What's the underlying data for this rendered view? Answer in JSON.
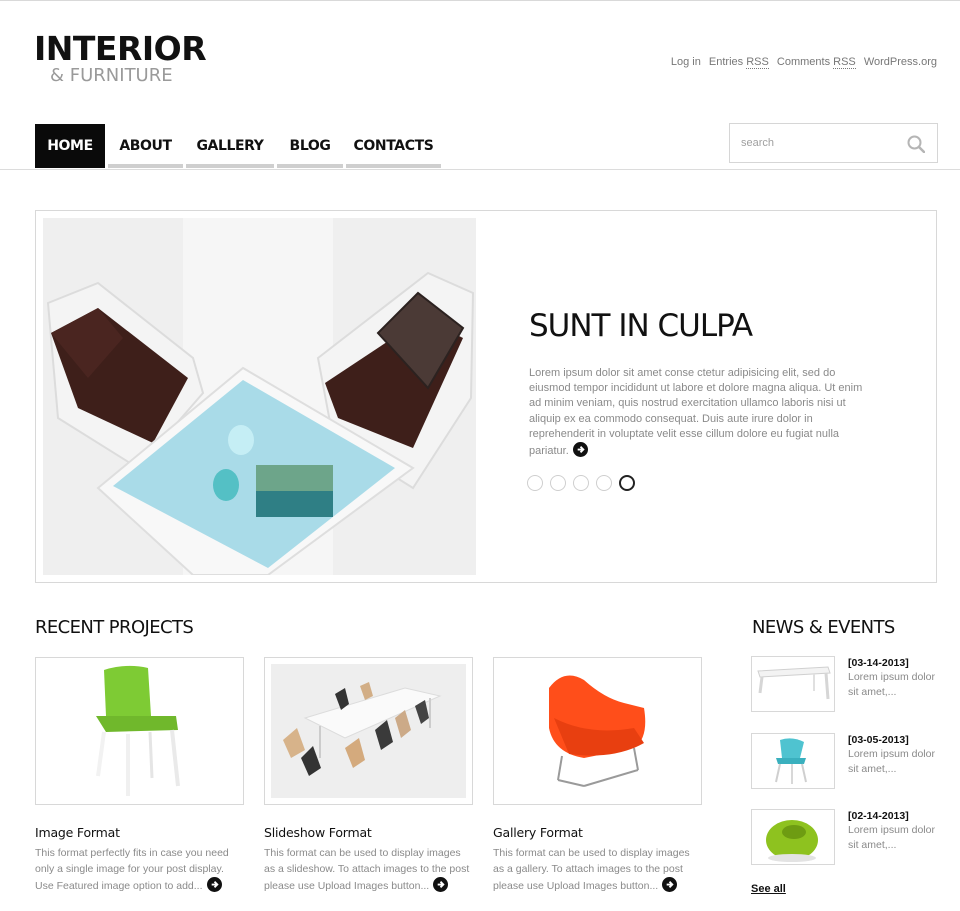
{
  "logo": {
    "title": "INTERIOR",
    "subtitle": "& FURNITURE"
  },
  "meta_links": [
    {
      "label": "Log in"
    },
    {
      "prefix": "Entries ",
      "abbr": "RSS"
    },
    {
      "prefix": "Comments ",
      "abbr": "RSS"
    },
    {
      "label": "WordPress.org"
    }
  ],
  "nav": [
    {
      "label": "HOME",
      "active": true
    },
    {
      "label": "ABOUT",
      "active": false
    },
    {
      "label": "GALLERY",
      "active": false
    },
    {
      "label": "BLOG",
      "active": false
    },
    {
      "label": "CONTACTS",
      "active": false
    }
  ],
  "search": {
    "placeholder": "search"
  },
  "slider": {
    "title": "SUNT IN CULPA",
    "text": "Lorem ipsum dolor sit amet conse ctetur adipisicing elit, sed do eiusmod tempor incididunt ut labore et dolore magna aliqua. Ut enim ad minim veniam, quis nostrud exercitation ullamco laboris nisi ut aliquip ex ea commodo consequat. Duis aute irure dolor in reprehenderit in voluptate velit esse cillum dolore eu fugiat nulla pariatur.",
    "dots": 5,
    "active_dot": 5
  },
  "recent_projects": {
    "heading": "RECENT PROJECTS",
    "items": [
      {
        "title": "Image Format",
        "text": "This format perfectly fits in case you need only a single image for your post display. Use Featured image option to add..."
      },
      {
        "title": "Slideshow Format",
        "text": "This format can be used to display images as a slideshow. To attach images to the post please use Upload Images button..."
      },
      {
        "title": "Gallery Format",
        "text": "This format can be used to display images as a gallery. To attach images to the post please use Upload Images button..."
      }
    ]
  },
  "news": {
    "heading": "NEWS & EVENTS",
    "items": [
      {
        "date": "[03-14-2013]",
        "text": "Lorem ipsum dolor sit amet,..."
      },
      {
        "date": "[03-05-2013]",
        "text": "Lorem ipsum dolor sit amet,..."
      },
      {
        "date": "[02-14-2013]",
        "text": "Lorem ipsum dolor sit amet,..."
      }
    ],
    "see_all": "See all"
  },
  "colors": {
    "text": "#111111",
    "muted": "#8a8a8a",
    "border": "#d8d8d8",
    "nav_active_bg": "#0a0a0a",
    "nav_underline": "#cfcfcf"
  }
}
